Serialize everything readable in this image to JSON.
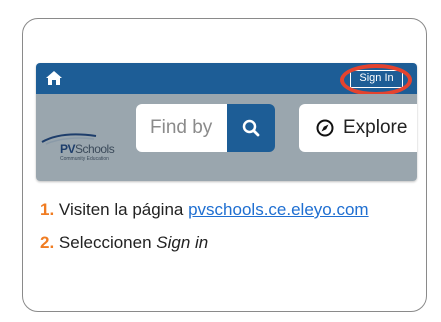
{
  "screenshot": {
    "sign_in_label": "Sign In",
    "logo_title_bold": "PV",
    "logo_title_rest": "Schools",
    "logo_subtitle": "Community Education",
    "search_placeholder": "Find by",
    "explore_label": "Explore",
    "topbar_color": "#1d5d96",
    "highlight_color": "#e4432e"
  },
  "steps": [
    {
      "number": "1.",
      "text": "Visiten la página ",
      "link": "pvschools.ce.eleyo.com"
    },
    {
      "number": "2.",
      "text": "Seleccionen ",
      "emphasis": "Sign in"
    }
  ],
  "icons": [
    "home-icon",
    "search-icon",
    "compass-icon",
    "pvschools-logo"
  ]
}
